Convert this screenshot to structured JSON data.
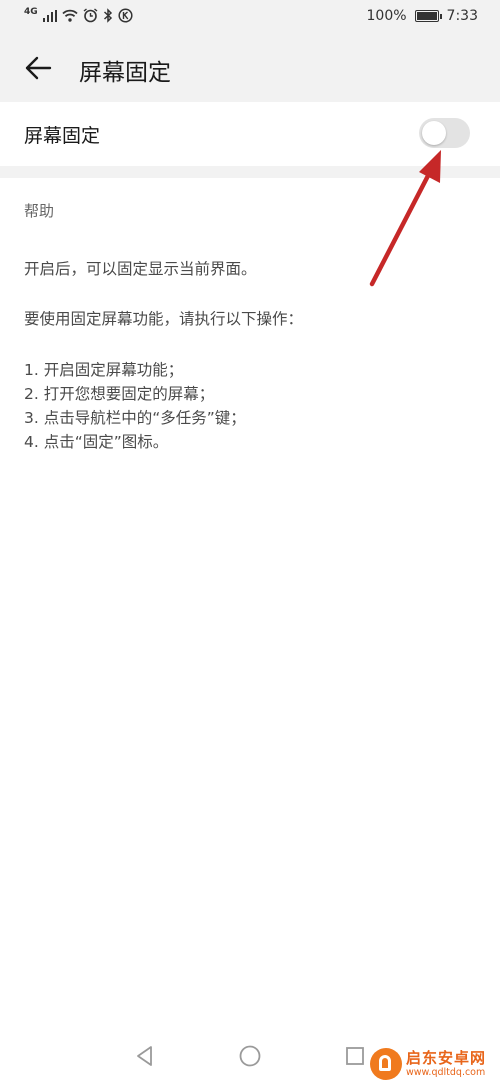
{
  "status_bar": {
    "network_label": "4G",
    "battery_percent": "100%",
    "time": "7:33"
  },
  "app_bar": {
    "title": "屏幕固定"
  },
  "setting": {
    "label": "屏幕固定",
    "enabled": false
  },
  "help": {
    "header": "帮助",
    "intro": "开启后，可以固定显示当前界面。",
    "lead": "要使用固定屏幕功能，请执行以下操作：",
    "steps": [
      "1. 开启固定屏幕功能；",
      "2. 打开您想要固定的屏幕；",
      "3. 点击导航栏中的“多任务”键；",
      "4. 点击“固定”图标。"
    ]
  },
  "watermark": {
    "title": "启东安卓网",
    "url": "www.qdltdq.com"
  },
  "colors": {
    "background": "#ffffff",
    "band": "#f2f2f2",
    "annotation_arrow": "#c62828",
    "watermark": "#e8651a"
  }
}
